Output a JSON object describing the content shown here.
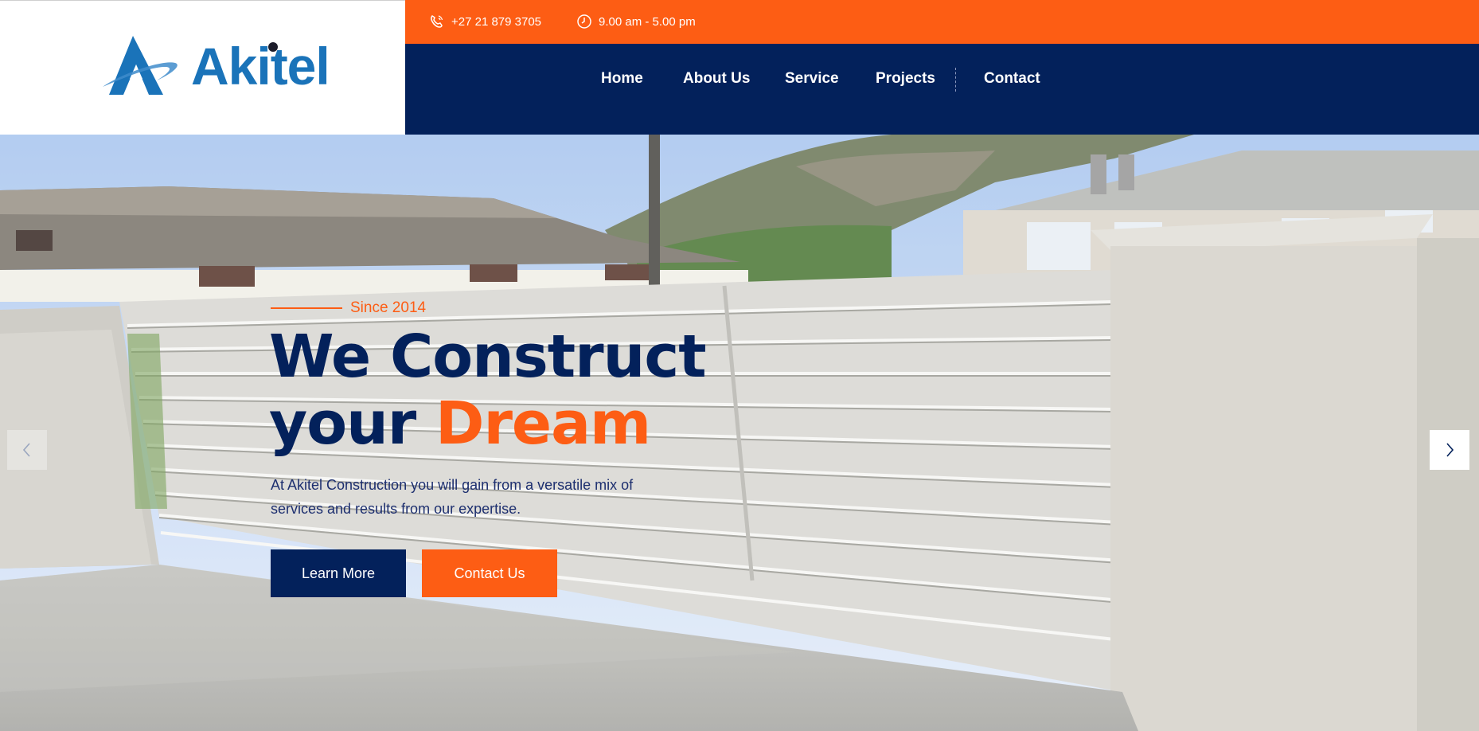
{
  "brand": {
    "name": "Akitel",
    "primary_color": "#03215b",
    "accent_color": "#fd5d14",
    "logo_color": "#1a73b9"
  },
  "topbar": {
    "phone": {
      "icon": "phone-icon",
      "text": "+27 21 879 3705"
    },
    "hours": {
      "icon": "clock-icon",
      "text": "9.00 am - 5.00 pm"
    }
  },
  "nav": {
    "items": [
      {
        "label": "Home"
      },
      {
        "label": "About Us"
      },
      {
        "label": "Service"
      },
      {
        "label": "Projects"
      },
      {
        "label": "Contact"
      }
    ]
  },
  "hero": {
    "since": "Since 2014",
    "headline_line1": "We Construct",
    "headline_line2_prefix": "your ",
    "headline_accent": "Dream",
    "subtext": "At Akitel Construction you will gain from a versatile mix of services and results from our expertise.",
    "primary_button": "Learn More",
    "secondary_button": "Contact Us",
    "prev_icon": "chevron-left-icon",
    "next_icon": "chevron-right-icon"
  }
}
